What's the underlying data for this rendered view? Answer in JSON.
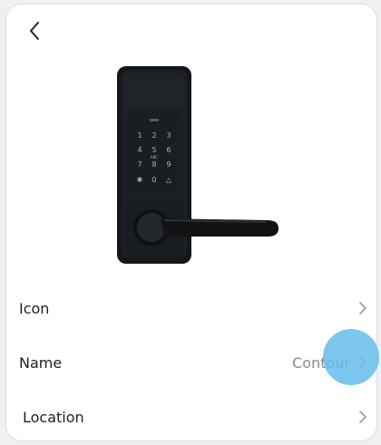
{
  "header": {
    "back_icon": "chevron-left-icon"
  },
  "device": {
    "image_icon": "smart-lock-image",
    "keypad_keys": [
      "1",
      "2",
      "3",
      "4",
      "5",
      "6",
      "7",
      "8",
      "9",
      "✱",
      "0",
      "△"
    ],
    "keypad_sublabels": {
      "ABC": "ABC"
    }
  },
  "settings": {
    "rows": [
      {
        "label": "Icon",
        "value": ""
      },
      {
        "label": "Name",
        "value": "Contour"
      },
      {
        "label": "Location",
        "value": ""
      }
    ]
  },
  "colors": {
    "background": "#eef0f2",
    "card": "#ffffff",
    "touch_indicator": "#66bcea",
    "chevron": "#9a9a9a"
  }
}
